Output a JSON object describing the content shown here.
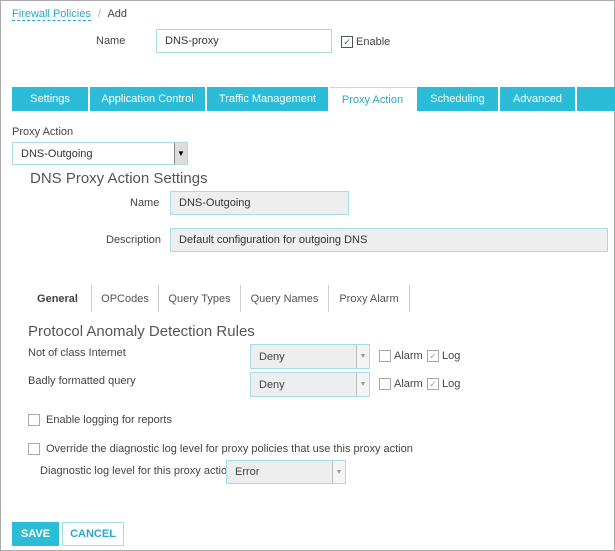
{
  "breadcrumb": {
    "parent": "Firewall Policies",
    "sep": "/",
    "current": "Add"
  },
  "policy": {
    "name_label": "Name",
    "name_value": "DNS-proxy",
    "enable_label": "Enable",
    "enabled": true
  },
  "tabs": [
    {
      "label": "Settings"
    },
    {
      "label": "Application Control"
    },
    {
      "label": "Traffic Management"
    },
    {
      "label": "Proxy Action",
      "active": true
    },
    {
      "label": "Scheduling"
    },
    {
      "label": "Advanced"
    }
  ],
  "proxy_action": {
    "label": "Proxy Action",
    "value": "DNS-Outgoing"
  },
  "settings": {
    "heading": "DNS Proxy Action Settings",
    "name_label": "Name",
    "name_value": "DNS-Outgoing",
    "desc_label": "Description",
    "desc_value": "Default configuration for outgoing DNS"
  },
  "subtabs": [
    {
      "label": "General",
      "active": true
    },
    {
      "label": "OPCodes"
    },
    {
      "label": "Query Types"
    },
    {
      "label": "Query Names"
    },
    {
      "label": "Proxy Alarm"
    }
  ],
  "rules": {
    "heading": "Protocol Anomaly Detection Rules",
    "items": [
      {
        "label": "Not of class Internet",
        "action": "Deny",
        "alarm_label": "Alarm",
        "alarm": false,
        "log_label": "Log",
        "log": true
      },
      {
        "label": "Badly formatted query",
        "action": "Deny",
        "alarm_label": "Alarm",
        "alarm": false,
        "log_label": "Log",
        "log": true
      }
    ]
  },
  "logging": {
    "enable_reports_label": "Enable logging for reports",
    "override_label": "Override the diagnostic log level for proxy policies that use this proxy action",
    "level_label": "Diagnostic log level for this proxy action",
    "level_value": "Error"
  },
  "buttons": {
    "save": "SAVE",
    "cancel": "CANCEL"
  },
  "colors": {
    "accent": "#2bbcd8"
  }
}
